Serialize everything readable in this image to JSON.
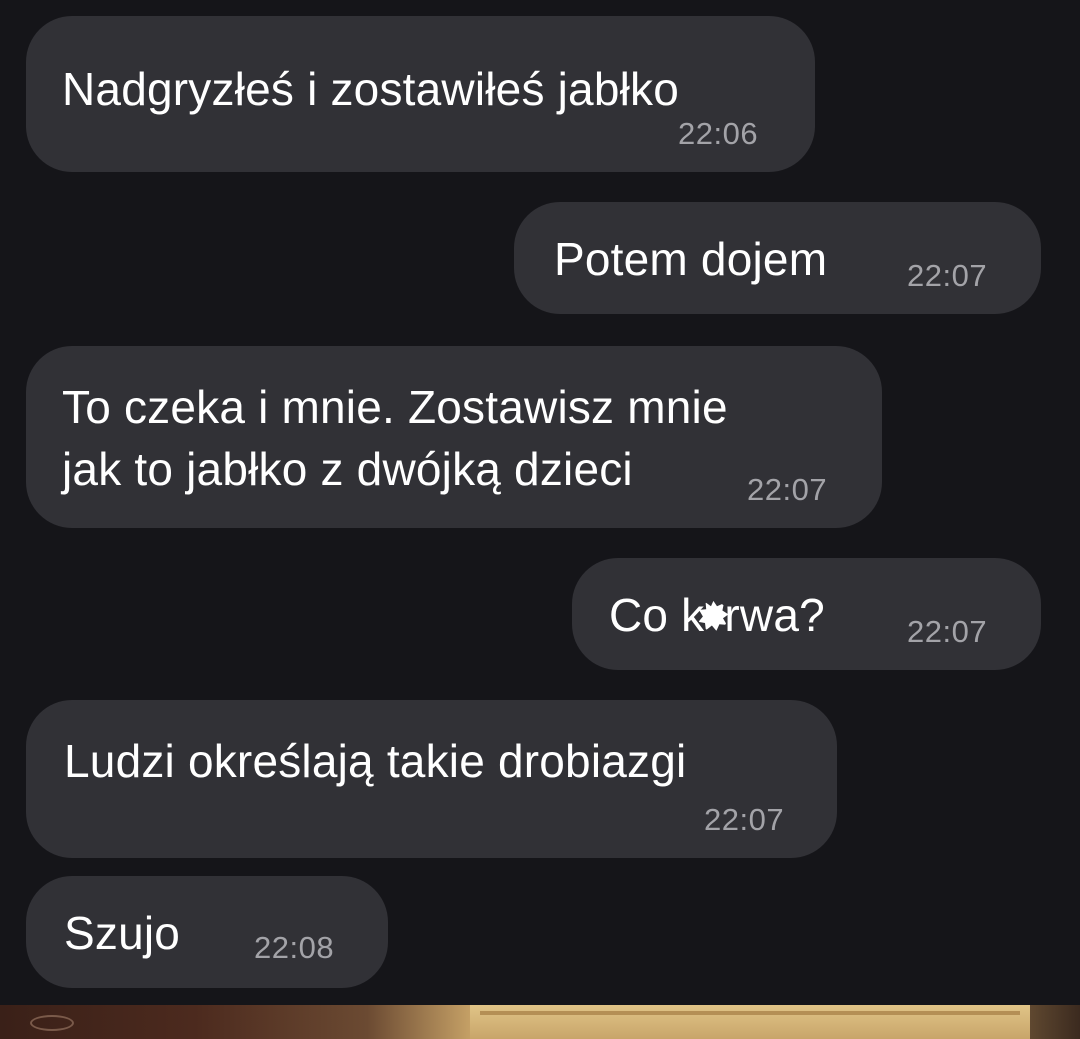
{
  "messages": [
    {
      "side": "incoming",
      "text": "Nadgryzłeś i zostawiłeś jabłko",
      "time": "22:06"
    },
    {
      "side": "outgoing",
      "text": "Potem dojem",
      "time": "22:07"
    },
    {
      "side": "incoming",
      "text": "To czeka i mnie. Zostawisz mnie\njak to jabłko z dwójką dzieci",
      "time": "22:07"
    },
    {
      "side": "outgoing",
      "text_before": "Co k",
      "text_after": "rwa?",
      "time": "22:07"
    },
    {
      "side": "incoming",
      "text": "Ludzi określają takie drobiazgi",
      "time": "22:07"
    },
    {
      "side": "incoming",
      "text": "Szujo",
      "time": "22:08"
    }
  ],
  "colors": {
    "background": "#151519",
    "bubble": "#313136",
    "text": "#ffffff",
    "time": "#a3a3a8"
  }
}
